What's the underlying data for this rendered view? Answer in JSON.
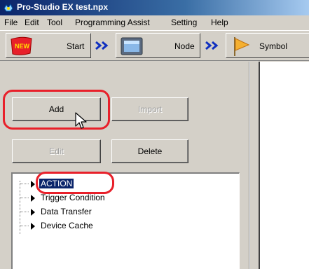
{
  "window": {
    "title": "Pro-Studio EX   test.npx"
  },
  "menu": [
    "File",
    "Edit",
    "Tool",
    "Programming Assist",
    "Setting",
    "Help"
  ],
  "steps": [
    {
      "label": "Start",
      "icon": "new-badge-icon"
    },
    {
      "label": "Node",
      "icon": "monitor-icon"
    },
    {
      "label": "Symbol",
      "icon": "flag-icon"
    }
  ],
  "buttons": {
    "add": "Add",
    "import": "Import",
    "edit": "Edit",
    "delete": "Delete"
  },
  "tree": {
    "items": [
      "ACTION",
      "Trigger Condition",
      "Data Transfer",
      "Device Cache"
    ],
    "selected": "ACTION"
  },
  "colors": {
    "highlight": "#e8202a",
    "selection": "#0a246a",
    "titlebar": "#0a246a"
  }
}
